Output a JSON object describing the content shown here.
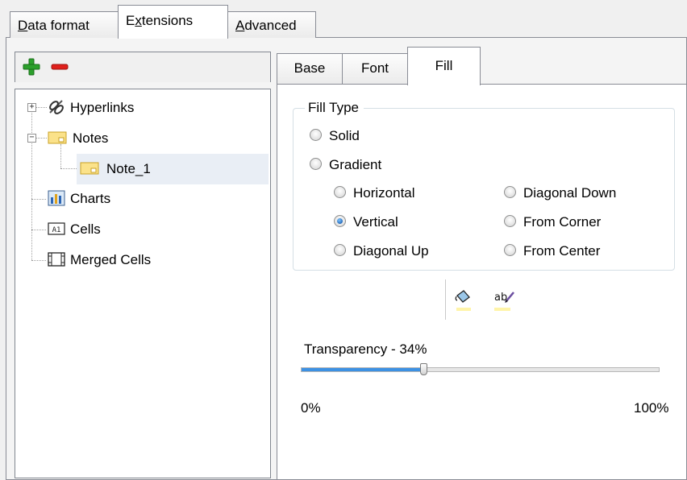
{
  "top_tabs": [
    {
      "pre": "",
      "accel": "D",
      "post": "ata format"
    },
    {
      "pre": "E",
      "accel": "x",
      "post": "tensions"
    },
    {
      "pre": "",
      "accel": "A",
      "post": "dvanced"
    }
  ],
  "tree": {
    "items": [
      {
        "label": "Hyperlinks",
        "icon": "hyperlink-icon"
      },
      {
        "label": "Notes",
        "icon": "note-folder-icon"
      },
      {
        "label": "Note_1",
        "icon": "note-icon"
      },
      {
        "label": "Charts",
        "icon": "chart-icon"
      },
      {
        "label": "Cells",
        "icon": "cell-icon"
      },
      {
        "label": "Merged Cells",
        "icon": "merged-cells-icon"
      }
    ]
  },
  "inner_tabs": [
    "Base",
    "Font",
    "Fill"
  ],
  "fill": {
    "group_title": "Fill Type",
    "solid_label": "Solid",
    "gradient_label": "Gradient",
    "options": {
      "horizontal": "Horizontal",
      "diagonal_down": "Diagonal Down",
      "vertical": "Vertical",
      "from_corner": "From Corner",
      "diagonal_up": "Diagonal Up",
      "from_center": "From Center"
    },
    "selected": "vertical"
  },
  "transparency": {
    "label": "Transparency - 34%",
    "value_percent": 34,
    "min_label": "0%",
    "max_label": "100%"
  },
  "colors": {
    "add": "#2ca02c",
    "remove": "#e0201b",
    "slider_fill": "#3d91e3",
    "selection": "#e9eef5"
  }
}
